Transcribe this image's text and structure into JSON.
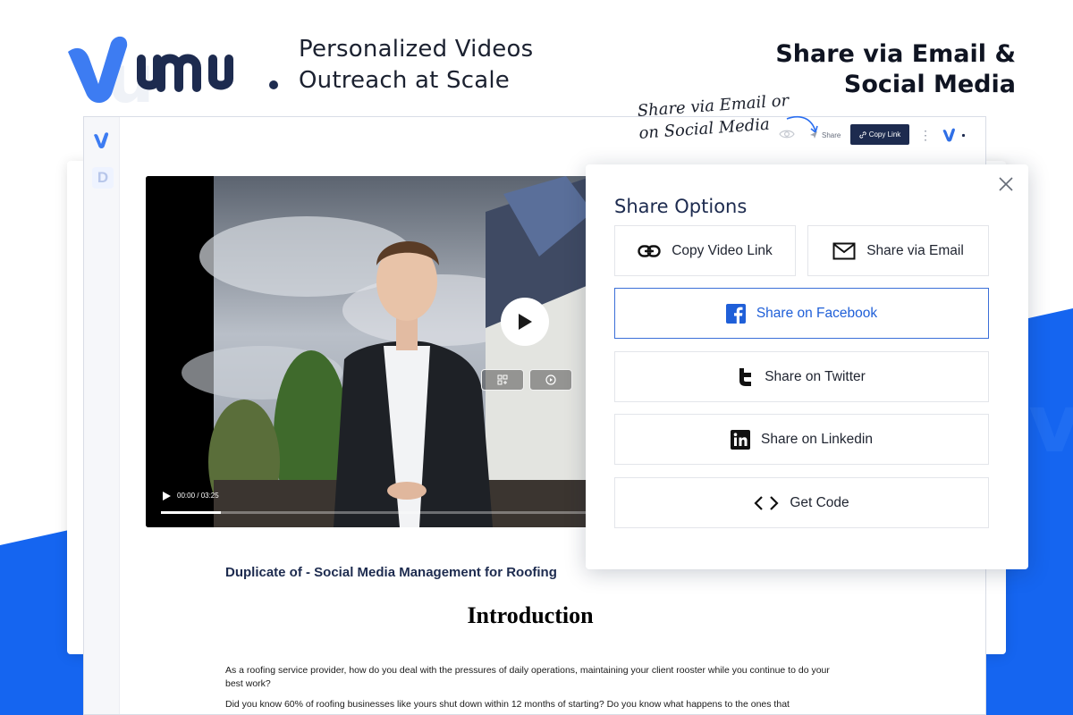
{
  "brand": {
    "tagline_line1": "Personalized Videos",
    "tagline_line2": "Outreach at Scale"
  },
  "headline": {
    "line1": "Share via Email &",
    "line2": "Social Media"
  },
  "annotation": {
    "line1": "Share via Email or",
    "line2": "on Social Media"
  },
  "toolbar": {
    "share_label": "Share",
    "copy_link_label": "Copy Link"
  },
  "video": {
    "time": "00:00 / 03:25",
    "progress": 0.14
  },
  "doc": {
    "title": "Duplicate of - Social Media Management for Roofing",
    "heading": "Introduction",
    "para1": "As a roofing service provider, how do you deal with the pressures of daily operations, maintaining your client rooster while you continue to do your best work?",
    "para2": "Did you know 60% of roofing businesses like yours shut down within 12 months of starting? Do you know what happens to the ones that"
  },
  "share_panel": {
    "title": "Share Options",
    "copy_video_link": "Copy Video Link",
    "share_via_email": "Share via Email",
    "facebook": "Share on Facebook",
    "twitter": "Share on Twitter",
    "linkedin": "Share on Linkedin",
    "get_code": "Get Code"
  },
  "colors": {
    "brand_blue": "#1f5fd8",
    "background_blue": "#1565f0",
    "navy": "#1d2b4f"
  }
}
